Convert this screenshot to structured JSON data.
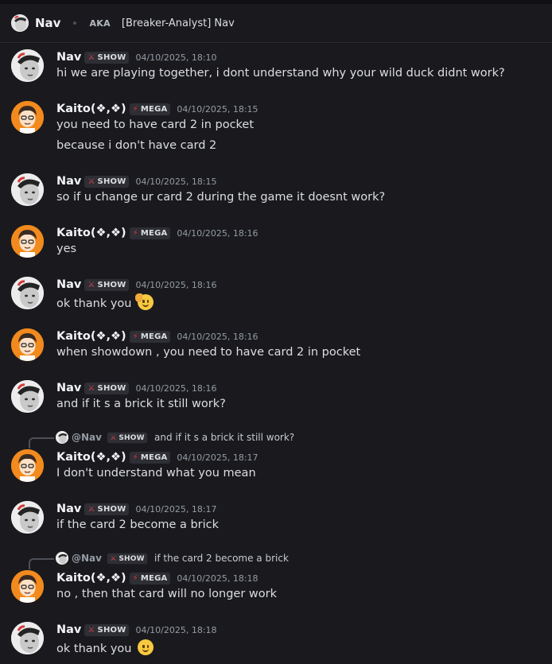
{
  "topbar": {
    "name": "Nav",
    "aka": "AKA",
    "alias": "[Breaker-Analyst] Nav"
  },
  "tags": {
    "nav": "SHOW",
    "kaito": "MEGA"
  },
  "colors": {
    "background": "#1a1a1e",
    "tag_background": "#2e2f35",
    "timestamp": "#949ba4",
    "kaito_avatar": "#f28a1e"
  },
  "messages": [
    {
      "author": "Nav",
      "tag": "SHOW",
      "time": "04/10/2025, 18:10",
      "lines": [
        "hi we are playing together, i dont understand why your wild duck didnt work?"
      ]
    },
    {
      "author": "Kaito(❖,❖)",
      "tag": "MEGA",
      "time": "04/10/2025, 18:15",
      "lines": [
        "you need to have card 2 in pocket",
        "because i don't have card 2"
      ]
    },
    {
      "author": "Nav",
      "tag": "SHOW",
      "time": "04/10/2025, 18:15",
      "lines": [
        "so if u change ur card 2 during the game it doesnt work?"
      ]
    },
    {
      "author": "Kaito(❖,❖)",
      "tag": "MEGA",
      "time": "04/10/2025, 18:16",
      "lines": [
        "yes"
      ]
    },
    {
      "author": "Nav",
      "tag": "SHOW",
      "time": "04/10/2025, 18:16",
      "lines": [
        "ok thank you"
      ]
    },
    {
      "author": "Kaito(❖,❖)",
      "tag": "MEGA",
      "time": "04/10/2025, 18:16",
      "lines": [
        "when showdown , you need to have card 2 in pocket"
      ]
    },
    {
      "author": "Nav",
      "tag": "SHOW",
      "time": "04/10/2025, 18:16",
      "lines": [
        "and if it s a brick it still work?"
      ]
    },
    {
      "reply_to": {
        "name": "@Nav",
        "tag": "SHOW",
        "text": "and if it s a brick it still work?"
      },
      "author": "Kaito(❖,❖)",
      "tag": "MEGA",
      "time": "04/10/2025, 18:17",
      "lines": [
        "I don't understand what you mean"
      ]
    },
    {
      "author": "Nav",
      "tag": "SHOW",
      "time": "04/10/2025, 18:17",
      "lines": [
        "if the card 2 become a brick"
      ]
    },
    {
      "reply_to": {
        "name": "@Nav",
        "tag": "SHOW",
        "text": "if the card 2 become a brick"
      },
      "author": "Kaito(❖,❖)",
      "tag": "MEGA",
      "time": "04/10/2025, 18:18",
      "lines": [
        "no , then that card will no longer work"
      ]
    },
    {
      "author": "Nav",
      "tag": "SHOW",
      "time": "04/10/2025, 18:18",
      "lines": [
        "ok thank you"
      ]
    }
  ]
}
